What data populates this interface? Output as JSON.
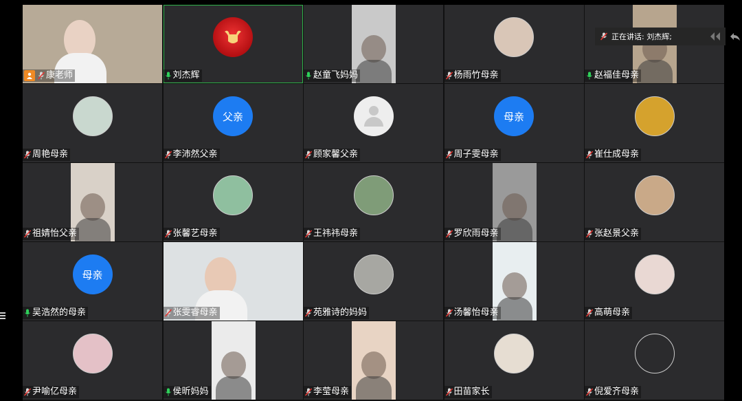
{
  "speaking_indicator": {
    "label": "正在讲话: 刘杰辉;"
  },
  "participants": [
    {
      "name": "康老师",
      "type": "video",
      "muted": true,
      "host": true,
      "bg": "#b7aa97",
      "face": "#e9d2c4"
    },
    {
      "name": "刘杰辉",
      "type": "logo",
      "muted": false,
      "speaking": true
    },
    {
      "name": "赵童飞妈妈",
      "type": "video-narrow",
      "muted": false,
      "bg": "#c9c9c9"
    },
    {
      "name": "杨雨竹母亲",
      "type": "photo-avatar",
      "muted": true,
      "avatar_color": "#d9c6b7"
    },
    {
      "name": "赵福佳母亲",
      "type": "video-narrow",
      "muted": false,
      "bg": "#b7a58e"
    },
    {
      "name": "周艳母亲",
      "type": "photo-avatar",
      "muted": true,
      "avatar_color": "#c9d8cf"
    },
    {
      "name": "李沛然父亲",
      "type": "text-avatar",
      "muted": true,
      "avatar_text": "父亲"
    },
    {
      "name": "顾家馨父亲",
      "type": "placeholder",
      "muted": true
    },
    {
      "name": "周子雯母亲",
      "type": "text-avatar",
      "muted": true,
      "avatar_text": "母亲"
    },
    {
      "name": "崔仕成母亲",
      "type": "photo-avatar",
      "muted": true,
      "avatar_color": "#d5a22d"
    },
    {
      "name": "祖婧怡父亲",
      "type": "video-narrow",
      "muted": true,
      "bg": "#d9d1c8"
    },
    {
      "name": "张馨艺母亲",
      "type": "photo-avatar",
      "muted": true,
      "avatar_color": "#8fbf9f"
    },
    {
      "name": "王祎祎母亲",
      "type": "photo-avatar",
      "muted": true,
      "avatar_color": "#7f9c78"
    },
    {
      "name": "罗欣雨母亲",
      "type": "video-narrow",
      "muted": true,
      "bg": "#9a9a9a"
    },
    {
      "name": "张赵景父亲",
      "type": "photo-avatar",
      "muted": true,
      "avatar_color": "#c9a988"
    },
    {
      "name": "吴浩然的母亲",
      "type": "text-avatar",
      "muted": false,
      "avatar_text": "母亲"
    },
    {
      "name": "张雯睿母亲",
      "type": "video",
      "muted": true,
      "bg": "#dde1e3",
      "face": "#e8c9b5"
    },
    {
      "name": "苑雅诗的妈妈",
      "type": "photo-avatar",
      "muted": true,
      "avatar_color": "#a7a7a2"
    },
    {
      "name": "汤馨怡母亲",
      "type": "video-narrow",
      "muted": true,
      "bg": "#e8eef0"
    },
    {
      "name": "高萌母亲",
      "type": "photo-avatar",
      "muted": true,
      "avatar_color": "#e9d8d3"
    },
    {
      "name": "尹喻亿母亲",
      "type": "photo-avatar",
      "muted": true,
      "avatar_color": "#e4c1c7"
    },
    {
      "name": "侯昕妈妈",
      "type": "video-narrow",
      "muted": false,
      "bg": "#ebebeb"
    },
    {
      "name": "李莹母亲",
      "type": "video-narrow",
      "muted": true,
      "bg": "#e8d4c4"
    },
    {
      "name": "田苗家长",
      "type": "photo-avatar",
      "muted": true,
      "avatar_color": "#e6ddd2"
    },
    {
      "name": "倪爱齐母亲",
      "type": "photo-avatar",
      "muted": true,
      "avatar_color": "#2b2b2d"
    }
  ]
}
